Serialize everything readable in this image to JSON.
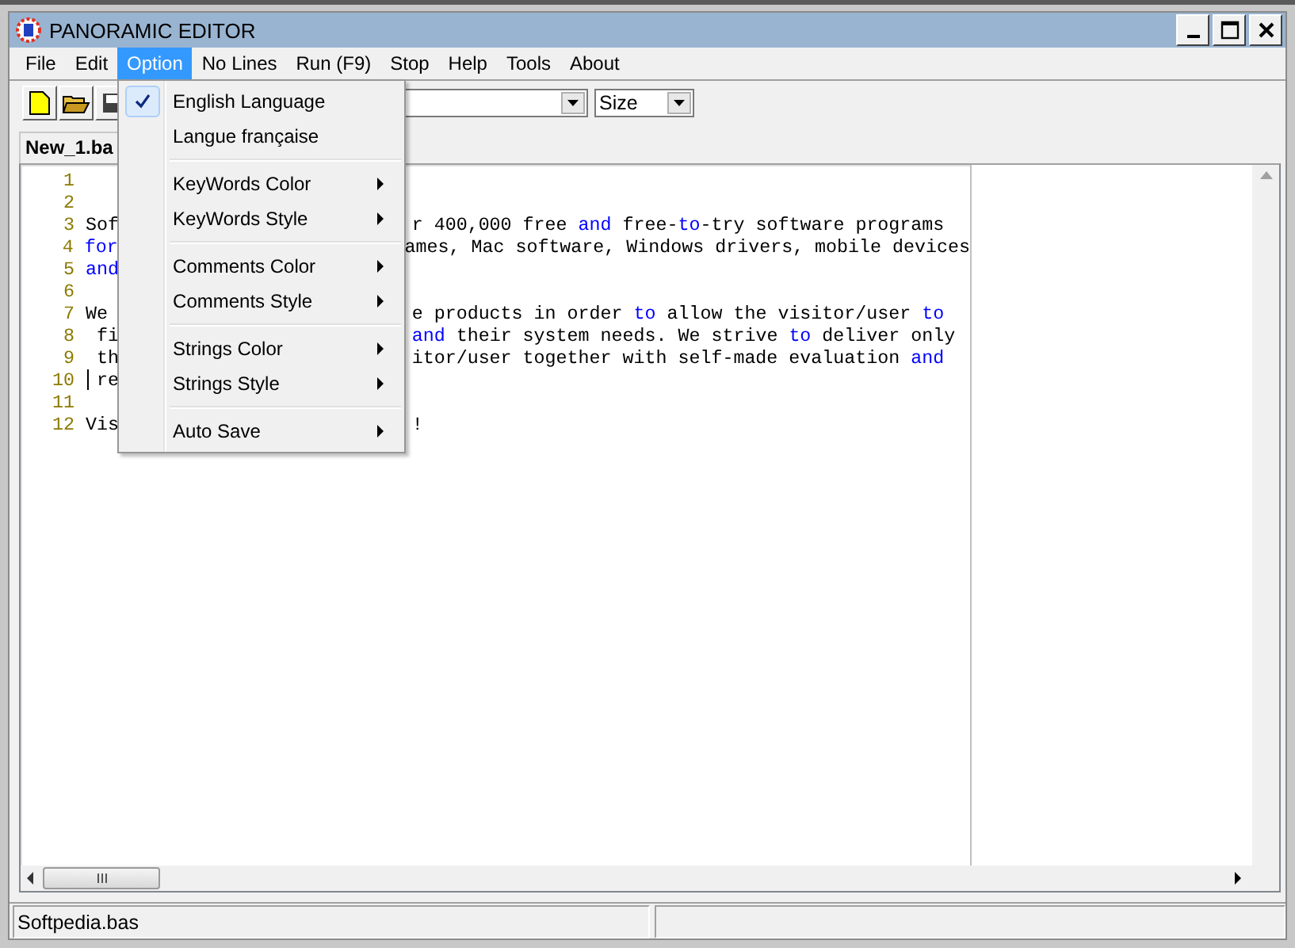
{
  "window": {
    "title": "PANORAMIC EDITOR"
  },
  "menu_bar": [
    {
      "label": "File",
      "selected": false
    },
    {
      "label": "Edit",
      "selected": false
    },
    {
      "label": "Option",
      "selected": true,
      "dropdown": [
        [
          {
            "label": "English Language",
            "checked": true,
            "submenu": false
          },
          {
            "label": "Langue française",
            "checked": false,
            "submenu": false
          }
        ],
        [
          {
            "label": "KeyWords Color",
            "checked": false,
            "submenu": true
          },
          {
            "label": "KeyWords Style",
            "checked": false,
            "submenu": true
          }
        ],
        [
          {
            "label": "Comments Color",
            "checked": false,
            "submenu": true
          },
          {
            "label": "Comments Style",
            "checked": false,
            "submenu": true
          }
        ],
        [
          {
            "label": "Strings Color",
            "checked": false,
            "submenu": true
          },
          {
            "label": "Strings Style",
            "checked": false,
            "submenu": true
          }
        ],
        [
          {
            "label": "Auto Save",
            "checked": false,
            "submenu": true
          }
        ]
      ]
    },
    {
      "label": "No Lines",
      "selected": false
    },
    {
      "label": "Run  (F9)",
      "selected": false
    },
    {
      "label": "Stop",
      "selected": false
    },
    {
      "label": "Help",
      "selected": false
    },
    {
      "label": "Tools",
      "selected": false
    },
    {
      "label": "About",
      "selected": false
    }
  ],
  "toolbar": {
    "size_combo": {
      "value": "Size"
    }
  },
  "tabs": [
    {
      "label": "New_1.ba",
      "selected": true
    }
  ],
  "editor": {
    "lines": [
      {
        "number": "1",
        "cursor": false
      },
      {
        "number": "2",
        "cursor": false
      },
      {
        "number": "3",
        "cursor": false,
        "left": [
          {
            "text": "Sof",
            "keyword": false
          }
        ],
        "right": [
          {
            "text": "r 400,000 free ",
            "keyword": false
          },
          {
            "text": "and",
            "keyword": true
          },
          {
            "text": " free-",
            "keyword": false
          },
          {
            "text": "to",
            "keyword": true
          },
          {
            "text": "-try software programs",
            "keyword": false
          }
        ]
      },
      {
        "number": "4",
        "cursor": false,
        "left": [
          {
            "text": "for",
            "keyword": true
          }
        ],
        "right": [
          {
            "text": "ames, Mac software, Windows drivers, mobile devices",
            "keyword": false
          }
        ]
      },
      {
        "number": "5",
        "cursor": false,
        "left": [
          {
            "text": "and",
            "keyword": true
          }
        ]
      },
      {
        "number": "6",
        "cursor": false
      },
      {
        "number": "7",
        "cursor": false,
        "left": [
          {
            "text": "We",
            "keyword": false
          }
        ],
        "right": [
          {
            "text": "e products in order ",
            "keyword": false
          },
          {
            "text": "to",
            "keyword": true
          },
          {
            "text": " allow the visitor/user ",
            "keyword": false
          },
          {
            "text": "to",
            "keyword": true
          }
        ]
      },
      {
        "number": "8",
        "cursor": false,
        "left": [
          {
            "text": " fi",
            "keyword": false
          }
        ],
        "right": [
          {
            "text": "and",
            "keyword": true
          },
          {
            "text": " their system needs. We strive ",
            "keyword": false
          },
          {
            "text": "to",
            "keyword": true
          },
          {
            "text": " deliver only",
            "keyword": false
          }
        ]
      },
      {
        "number": "9",
        "cursor": false,
        "left": [
          {
            "text": " th",
            "keyword": false
          }
        ],
        "right": [
          {
            "text": "itor/user together with self-made evaluation ",
            "keyword": false
          },
          {
            "text": "and",
            "keyword": true
          }
        ]
      },
      {
        "number": "10",
        "cursor": true,
        "left": [
          {
            "text": "re",
            "keyword": false
          }
        ]
      },
      {
        "number": "11",
        "cursor": false
      },
      {
        "number": "12",
        "cursor": false,
        "left": [
          {
            "text": "Vis",
            "keyword": false
          }
        ],
        "right": [
          {
            "text": "!",
            "keyword": false
          }
        ]
      }
    ]
  },
  "status_bar": [
    {
      "text": "Softpedia.bas"
    }
  ]
}
